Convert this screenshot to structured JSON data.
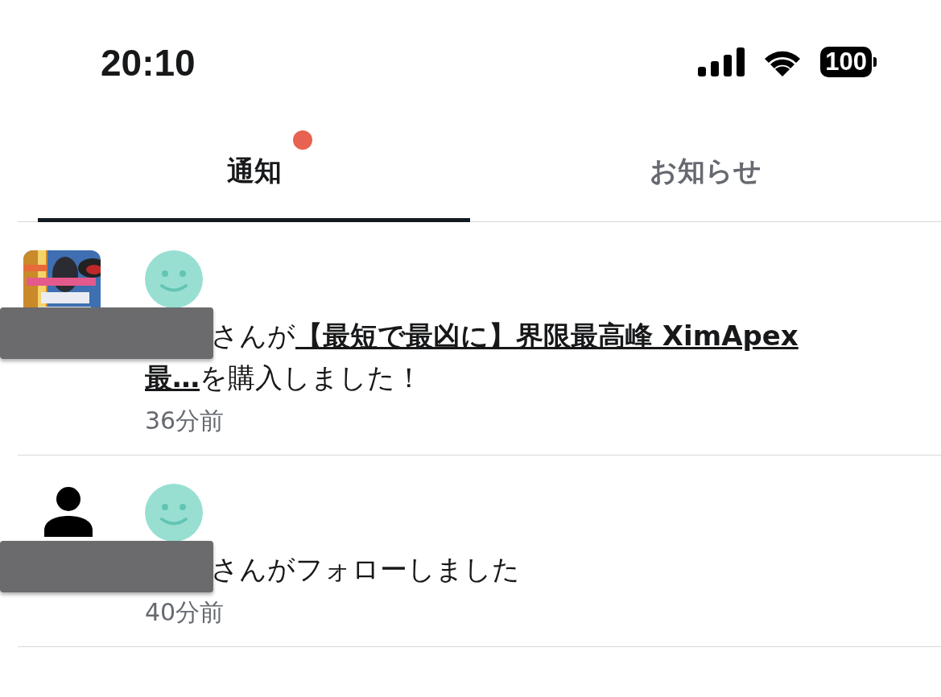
{
  "status_bar": {
    "time": "20:10",
    "battery": "100"
  },
  "tabs": [
    {
      "label": "通知",
      "selected": true,
      "badge": true
    },
    {
      "label": "お知らせ",
      "selected": false,
      "badge": false
    }
  ],
  "notifications": [
    {
      "kind": "purchase",
      "text_before": "さんが",
      "link": [
        "【最短で最凶に】界限最高峰 XimApex",
        "最…"
      ],
      "text_after": "を購入しました！",
      "time": "36分前",
      "redacted": true
    },
    {
      "kind": "follow",
      "text_before": "さんがフォローしました",
      "time": "40分前",
      "redacted": true
    }
  ]
}
